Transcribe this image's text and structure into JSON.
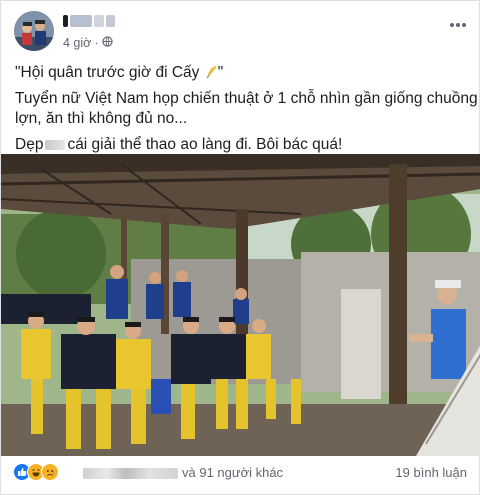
{
  "post": {
    "author_name": "",
    "time": "4 giờ",
    "time_separator": "·",
    "privacy_icon": "globe-icon",
    "more_icon": "ellipsis-icon"
  },
  "content": {
    "line1": "\"Hội quân trước giờ đi Cấy ",
    "line1_end": "\"",
    "line2": "Tuyển nữ Việt Nam họp chiến thuật ở 1 chỗ nhìn gần giống chuồng",
    "line3": "lợn, ăn thì không đủ no...",
    "line4_start": "Dẹp",
    "line4_end": "cái giải thể thao ao làng đi. Bôi bác quá!",
    "emoji_icon": "rice-plant-icon"
  },
  "footer": {
    "reaction_icons": [
      "like-icon",
      "haha-icon",
      "sad-icon"
    ],
    "reactions_text": "và 91 người khác",
    "comments_text": "19 bình luận"
  },
  "colors": {
    "like": "#1877f2",
    "emoji": "#f7b125",
    "secondary_text": "#606770"
  }
}
